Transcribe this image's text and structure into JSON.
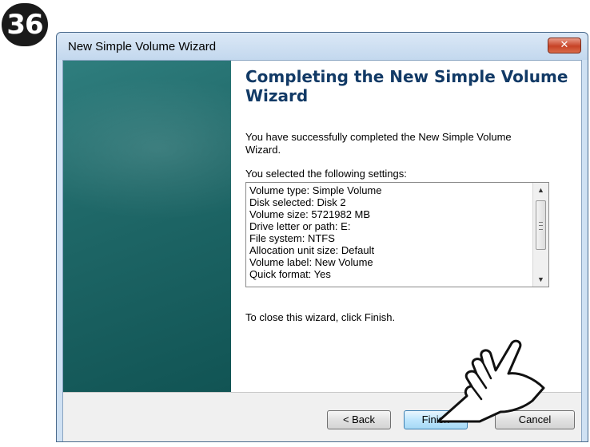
{
  "step_badge": "36",
  "window": {
    "title": "New Simple Volume Wizard",
    "close_label": "✕"
  },
  "wizard": {
    "heading": "Completing the New Simple Volume Wizard",
    "intro": "You have successfully completed the New Simple Volume Wizard.",
    "settings_label": "You selected the following settings:",
    "settings": [
      "Volume type: Simple Volume",
      "Disk selected: Disk 2",
      "Volume size: 5721982 MB",
      "Drive letter or path: E:",
      "File system: NTFS",
      "Allocation unit size: Default",
      "Volume label: New Volume",
      "Quick format: Yes"
    ],
    "close_hint": "To close this wizard, click Finish."
  },
  "buttons": {
    "back": "< Back",
    "finish": "Finish",
    "cancel": "Cancel"
  },
  "icons": {
    "pointer": "pointing-hand-icon",
    "close": "close-icon"
  },
  "colors": {
    "heading": "#123a66",
    "side_panel": "#1f6868",
    "close_button": "#c74326"
  }
}
